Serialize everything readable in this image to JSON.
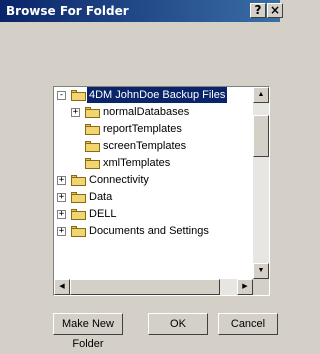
{
  "window": {
    "title": "Browse For Folder",
    "help_btn": "?",
    "close_btn": "×"
  },
  "tree": {
    "items": [
      {
        "label": "4DM JohnDoe Backup Files",
        "expander": "-",
        "selected": true
      },
      {
        "label": "normalDatabases",
        "expander": "+"
      },
      {
        "label": "reportTemplates",
        "expander": ""
      },
      {
        "label": "screenTemplates",
        "expander": ""
      },
      {
        "label": "xmlTemplates",
        "expander": ""
      },
      {
        "label": "Connectivity",
        "expander": "+"
      },
      {
        "label": "Data",
        "expander": "+"
      },
      {
        "label": "DELL",
        "expander": "+"
      },
      {
        "label": "Documents and Settings",
        "expander": "+"
      }
    ]
  },
  "buttons": {
    "new_folder": "Make New Folder",
    "ok": "OK",
    "cancel": "Cancel"
  },
  "scroll": {
    "up": "▲",
    "down": "▼",
    "left": "◀",
    "right": "▶"
  },
  "colors": {
    "titlebar_start": "#0a246a",
    "titlebar_end": "#3a6ea5",
    "selection": "#0a246a",
    "face": "#d4d0c8"
  }
}
